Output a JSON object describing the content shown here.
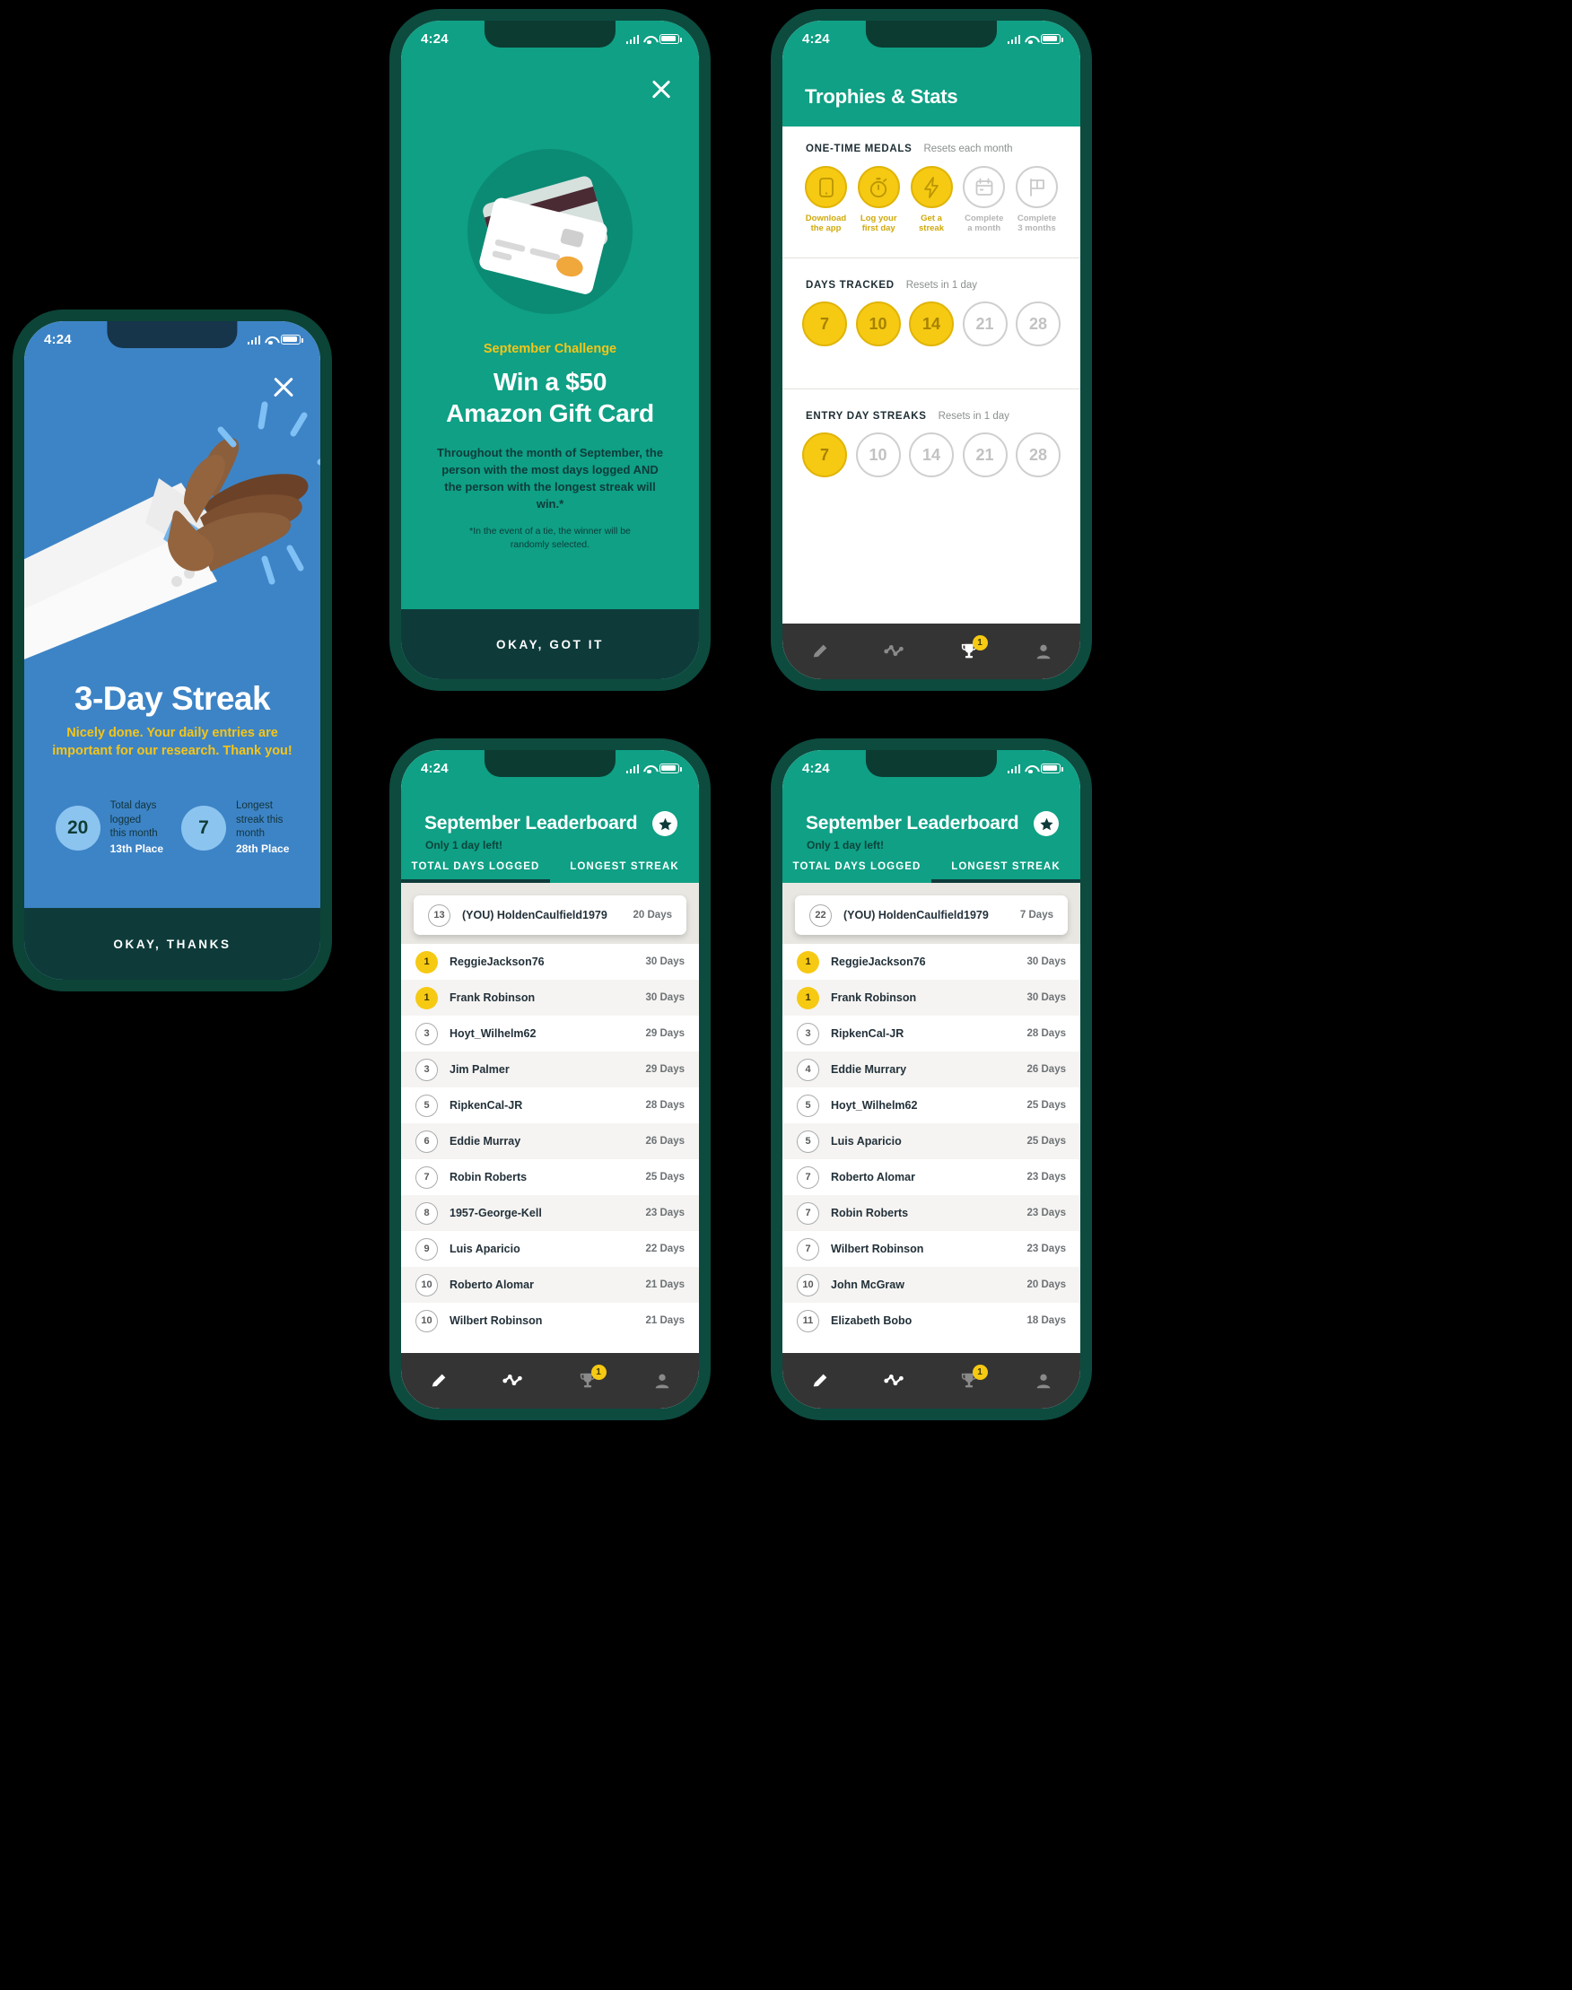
{
  "status_bar": {
    "time": "4:24"
  },
  "streak_screen": {
    "name": "3-day-streak-celebration",
    "close_icon": "close-icon",
    "illustration": "clapping-hands-illustration",
    "title": "3-Day Streak",
    "subtitle": "Nicely done. Your daily entries are important for our research. Thank you!",
    "stats": [
      {
        "value": "20",
        "label_lines": [
          "Total days",
          "logged",
          "this month"
        ],
        "place": "13th Place"
      },
      {
        "value": "7",
        "label_lines": [
          "Longest",
          "streak this",
          "month"
        ],
        "place": "28th Place"
      }
    ],
    "button_label": "OKAY, THANKS"
  },
  "challenge_screen": {
    "name": "september-challenge-modal",
    "close_icon": "close-icon",
    "illustration": "gift-card-illustration",
    "eyebrow": "September Challenge",
    "heading_line1": "Win a $50",
    "heading_line2": "Amazon Gift Card",
    "paragraph": "Throughout the month of September, the person with the most days logged AND the person with the longest streak will win.*",
    "footnote": "*In the event of a tie, the winner will be randomly selected.",
    "button_label": "OKAY, GOT IT"
  },
  "trophies_screen": {
    "name": "trophies-and-stats",
    "title": "Trophies & Stats",
    "sections": [
      {
        "heading": "ONE-TIME MEDALS",
        "reset_note": "Resets each month",
        "medals": [
          {
            "icon": "phone-icon",
            "label": "Download\nthe app",
            "earned": true
          },
          {
            "icon": "stopwatch-icon",
            "label": "Log your\nfirst day",
            "earned": true
          },
          {
            "icon": "lightning-icon",
            "label": "Get a\nstreak",
            "earned": true
          },
          {
            "icon": "calendar-icon",
            "label": "Complete\na month",
            "earned": false
          },
          {
            "icon": "flag-icon",
            "label": "Complete\n3 months",
            "earned": false
          }
        ]
      },
      {
        "heading": "DAYS TRACKED",
        "reset_note": "Resets in 1 day",
        "badges": [
          {
            "value": "7",
            "earned": true
          },
          {
            "value": "10",
            "earned": true
          },
          {
            "value": "14",
            "earned": true
          },
          {
            "value": "21",
            "earned": false
          },
          {
            "value": "28",
            "earned": false
          }
        ]
      },
      {
        "heading": "ENTRY DAY STREAKS",
        "reset_note": "Resets in 1 day",
        "badges": [
          {
            "value": "7",
            "earned": true
          },
          {
            "value": "10",
            "earned": false
          },
          {
            "value": "14",
            "earned": false
          },
          {
            "value": "21",
            "earned": false
          },
          {
            "value": "28",
            "earned": false
          }
        ]
      }
    ]
  },
  "leaderboard_days": {
    "name": "september-leaderboard-total-days",
    "title": "September Leaderboard",
    "subtitle": "Only 1 day left!",
    "star_icon": "star-icon",
    "tabs": [
      {
        "label": "TOTAL DAYS LOGGED",
        "active": true
      },
      {
        "label": "LONGEST STREAK",
        "active": false
      }
    ],
    "you_row": {
      "rank": "13",
      "name": "(YOU) HoldenCaulfield1979",
      "days": "20 Days"
    },
    "rows": [
      {
        "rank": "1",
        "gold": true,
        "name": "ReggieJackson76",
        "days": "30 Days"
      },
      {
        "rank": "1",
        "gold": true,
        "name": "Frank Robinson",
        "days": "30 Days"
      },
      {
        "rank": "3",
        "gold": false,
        "name": "Hoyt_Wilhelm62",
        "days": "29 Days"
      },
      {
        "rank": "3",
        "gold": false,
        "name": "Jim Palmer",
        "days": "29 Days"
      },
      {
        "rank": "5",
        "gold": false,
        "name": "RipkenCal-JR",
        "days": "28 Days"
      },
      {
        "rank": "6",
        "gold": false,
        "name": "Eddie Murray",
        "days": "26 Days"
      },
      {
        "rank": "7",
        "gold": false,
        "name": "Robin Roberts",
        "days": "25 Days"
      },
      {
        "rank": "8",
        "gold": false,
        "name": "1957-George-Kell",
        "days": "23 Days"
      },
      {
        "rank": "9",
        "gold": false,
        "name": "Luis Aparicio",
        "days": "22 Days"
      },
      {
        "rank": "10",
        "gold": false,
        "name": "Roberto Alomar",
        "days": "21 Days"
      },
      {
        "rank": "10",
        "gold": false,
        "name": "Wilbert Robinson",
        "days": "21 Days"
      }
    ]
  },
  "leaderboard_streak": {
    "name": "september-leaderboard-longest-streak",
    "title": "September Leaderboard",
    "subtitle": "Only 1 day left!",
    "star_icon": "star-icon",
    "tabs": [
      {
        "label": "TOTAL DAYS LOGGED",
        "active": false
      },
      {
        "label": "LONGEST STREAK",
        "active": true
      }
    ],
    "you_row": {
      "rank": "22",
      "name": "(YOU) HoldenCaulfield1979",
      "days": "7 Days"
    },
    "rows": [
      {
        "rank": "1",
        "gold": true,
        "name": "ReggieJackson76",
        "days": "30 Days"
      },
      {
        "rank": "1",
        "gold": true,
        "name": "Frank Robinson",
        "days": "30 Days"
      },
      {
        "rank": "3",
        "gold": false,
        "name": "RipkenCal-JR",
        "days": "28 Days"
      },
      {
        "rank": "4",
        "gold": false,
        "name": "Eddie Murrary",
        "days": "26 Days"
      },
      {
        "rank": "5",
        "gold": false,
        "name": "Hoyt_Wilhelm62",
        "days": "25 Days"
      },
      {
        "rank": "5",
        "gold": false,
        "name": "Luis Aparicio",
        "days": "25 Days"
      },
      {
        "rank": "7",
        "gold": false,
        "name": "Roberto Alomar",
        "days": "23 Days"
      },
      {
        "rank": "7",
        "gold": false,
        "name": "Robin Roberts",
        "days": "23 Days"
      },
      {
        "rank": "7",
        "gold": false,
        "name": "Wilbert Robinson",
        "days": "23 Days"
      },
      {
        "rank": "10",
        "gold": false,
        "name": "John McGraw",
        "days": "20 Days"
      },
      {
        "rank": "11",
        "gold": false,
        "name": "Elizabeth Bobo",
        "days": "18 Days"
      }
    ]
  },
  "bottom_nav": {
    "items": [
      {
        "icon": "pencil-icon",
        "badge": null
      },
      {
        "icon": "chart-icon",
        "badge": null
      },
      {
        "icon": "trophy-icon",
        "badge": "1",
        "active": true
      },
      {
        "icon": "person-icon",
        "badge": null
      }
    ]
  },
  "colors": {
    "teal": "#0fa085",
    "dark_teal": "#0e3b3a",
    "blue": "#3d84c6",
    "gold": "#f6c913",
    "nav_bg": "#343434"
  }
}
